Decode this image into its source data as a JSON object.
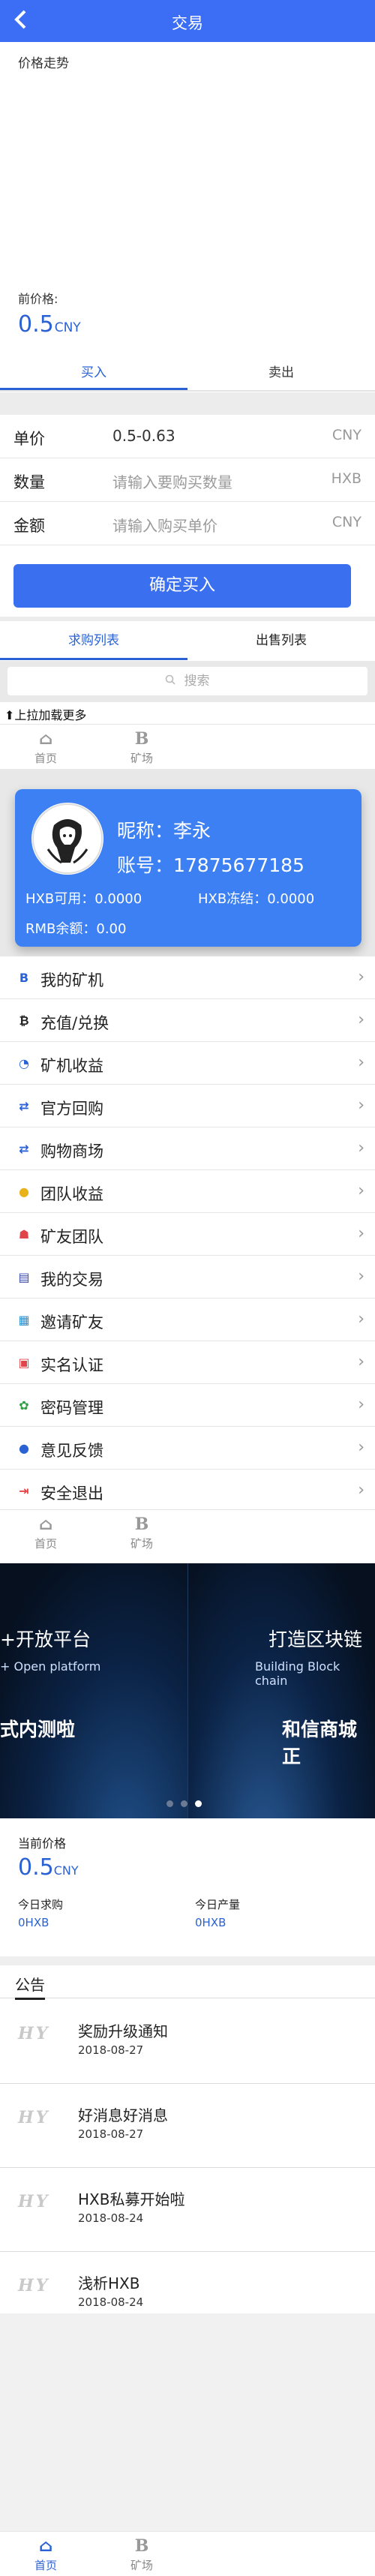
{
  "header": {
    "title": "交易",
    "back_icon": "back-arrow-icon"
  },
  "chart": {
    "label": "价格走势"
  },
  "price": {
    "label": "前价格:",
    "value": "0.5",
    "unit": "CNY"
  },
  "trade_tabs": [
    {
      "label": "买入",
      "active": true
    },
    {
      "label": "卖出",
      "active": false
    }
  ],
  "buy_form": {
    "price": {
      "label": "单价",
      "value": "0.5-0.63",
      "unit": "CNY"
    },
    "qty": {
      "label": "数量",
      "placeholder": "请输入要购买数量",
      "unit": "HXB"
    },
    "amount": {
      "label": "金额",
      "placeholder": "请输入购买单价",
      "unit": "CNY"
    },
    "submit": "确定买入"
  },
  "list_tabs": [
    {
      "label": "求购列表",
      "active": true
    },
    {
      "label": "出售列表",
      "active": false
    }
  ],
  "search": {
    "placeholder": "搜索"
  },
  "pull_more": "上拉加载更多",
  "tabbar": {
    "home": "首页",
    "mine": "矿场"
  },
  "profile": {
    "nickname": "昵称：李永",
    "account": "账号：17875677185",
    "hxb_available": "HXB可用：0.0000",
    "hxb_frozen": "HXB冻结：0.0000",
    "rmb_balance": "RMB余额：0.00"
  },
  "menu": [
    {
      "label": "我的矿机",
      "icon": "B",
      "color": "#2a62d5",
      "name": "my-miner"
    },
    {
      "label": "充值/兑换",
      "icon": "₿",
      "color": "#222",
      "name": "recharge"
    },
    {
      "label": "矿机收益",
      "icon": "◔",
      "color": "#2a62d5",
      "name": "miner-income"
    },
    {
      "label": "官方回购",
      "icon": "⇄",
      "color": "#2a62d5",
      "name": "buyback"
    },
    {
      "label": "购物商场",
      "icon": "⇄",
      "color": "#2a62d5",
      "name": "mall"
    },
    {
      "label": "团队收益",
      "icon": "●",
      "color": "#e8b21a",
      "name": "team-income"
    },
    {
      "label": "矿友团队",
      "icon": "☗",
      "color": "#e0454a",
      "name": "team"
    },
    {
      "label": "我的交易",
      "icon": "▤",
      "color": "#3a4bb0",
      "name": "my-trade"
    },
    {
      "label": "邀请矿友",
      "icon": "▦",
      "color": "#2c8fd0",
      "name": "invite"
    },
    {
      "label": "实名认证",
      "icon": "▣",
      "color": "#e0454a",
      "name": "realname"
    },
    {
      "label": "密码管理",
      "icon": "✿",
      "color": "#2f9e44",
      "name": "password"
    },
    {
      "label": "意见反馈",
      "icon": "●",
      "color": "#2a62d5",
      "name": "feedback"
    },
    {
      "label": "安全退出",
      "icon": "⇥",
      "color": "#e0454a",
      "name": "logout"
    }
  ],
  "banner": {
    "slide1_title": "+开放平台",
    "slide1_sub": "+ Open platform",
    "slide1_bottom": "式内测啦",
    "slide2_title": "打造区块链",
    "slide2_sub": "Building Block chain",
    "slide2_bottom": "和信商城正"
  },
  "stats": {
    "current_label": "当前价格",
    "current_value": "0.5",
    "current_unit": "CNY",
    "today_buy_label": "今日求购",
    "today_buy_value": "0HXB",
    "today_out_label": "今日产量",
    "today_out_value": "0HXB"
  },
  "notices": {
    "heading": "公告",
    "logo_text": "HY",
    "items": [
      {
        "title": "奖励升级通知",
        "date": "2018-08-27"
      },
      {
        "title": "好消息好消息",
        "date": "2018-08-27"
      },
      {
        "title": "HXB私募开始啦",
        "date": "2018-08-24"
      },
      {
        "title": "浅析HXB",
        "date": "2018-08-24"
      }
    ]
  },
  "colors": {
    "primary": "#3b6ef5",
    "accent": "#2a62d5"
  }
}
